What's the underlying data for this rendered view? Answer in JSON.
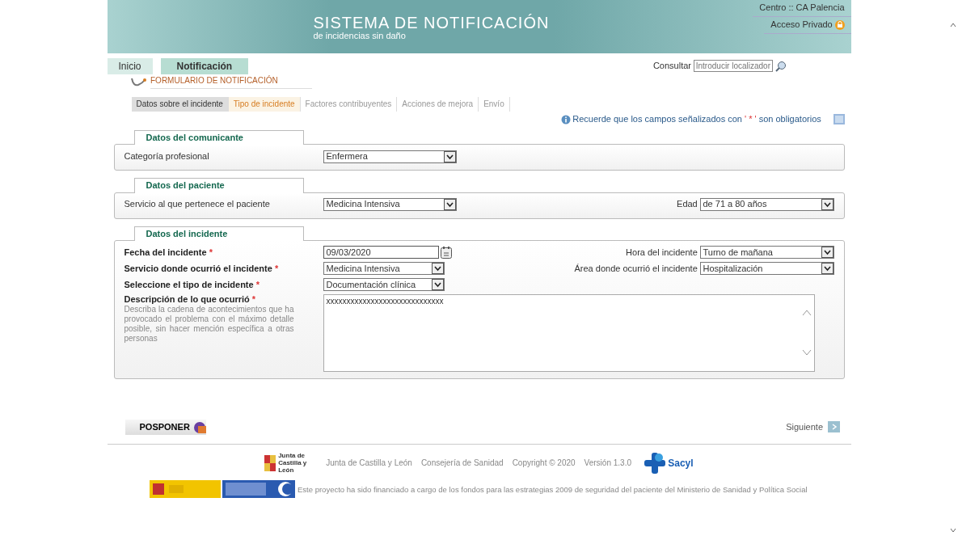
{
  "header": {
    "title": "SISTEMA DE NOTIFICACIÓN",
    "subtitle": "de incidencias sin daño",
    "centro": "Centro :: CA Palencia",
    "acceso": "Acceso Privado"
  },
  "main_tabs": [
    {
      "label": "Inicio",
      "selected": false
    },
    {
      "label": "Notificación",
      "selected": true
    }
  ],
  "search": {
    "label": "Consultar",
    "placeholder": "Introducir localizador"
  },
  "form_title": "FORMULARIO DE NOTIFICACIÓN",
  "form_tabs": [
    {
      "label": "Datos sobre el incidente",
      "selected": true,
      "enabled": true
    },
    {
      "label": "Tipo de incidente",
      "selected": false,
      "enabled": true
    },
    {
      "label": "Factores contribuyentes",
      "selected": false,
      "enabled": false
    },
    {
      "label": "Acciones de mejora",
      "selected": false,
      "enabled": false
    },
    {
      "label": "Envío",
      "selected": false,
      "enabled": false
    }
  ],
  "note": {
    "before": "Recuerde que los campos señalizados con",
    "mark": "' * '",
    "after": "son obligatorios"
  },
  "sections": [
    {
      "legend": "Datos del comunicante",
      "left": [
        {
          "label": "Categoría profesional",
          "required": false,
          "kind": "select",
          "value": "Enfermera"
        }
      ]
    },
    {
      "legend": "Datos del paciente",
      "left": [
        {
          "label": "Servicio al que pertenece el paciente",
          "required": false,
          "kind": "select",
          "value": "Medicina Intensiva"
        }
      ],
      "right": [
        {
          "label": "Edad",
          "kind": "select",
          "value": "de 71 a 80 años"
        }
      ]
    },
    {
      "legend": "Datos del incidente",
      "left": [
        {
          "label": "Fecha del incidente",
          "required": true,
          "required_mark": "*",
          "kind": "date",
          "value": "09/03/2020"
        },
        {
          "label": "Servicio donde ocurrió el incidente",
          "required": true,
          "required_mark": "*",
          "kind": "select",
          "value": "Medicina Intensiva"
        },
        {
          "label": "Seleccione el tipo de incidente",
          "required": true,
          "required_mark": "*",
          "kind": "select",
          "value": "Documentación clínica"
        },
        {
          "label": "Descripción de lo que ocurrió",
          "required": true,
          "required_mark": "*",
          "kind": "textarea",
          "hint": "Describa la cadena de acontecimientos que ha provocado el problema con el máximo detalle posible, sin hacer mención específica a otras personas",
          "value": "xxxxxxxxxxxxxxxxxxxxxxxxxxxxx"
        }
      ],
      "right": [
        {
          "label": "Hora del incidente",
          "kind": "select",
          "value": "Turno de mañana"
        },
        {
          "label": "Área donde ocurrió el incidente",
          "kind": "select",
          "value": "Hospitalización"
        }
      ]
    }
  ],
  "buttons": {
    "postpone": "POSPONER",
    "next": "Siguiente"
  },
  "footer": {
    "junta_logo": "Junta de Castilla y León",
    "links": [
      "Junta de Castilla y León",
      "Consejería de Sanidad",
      "Copyright © 2020",
      "Versión 1.3.0"
    ],
    "sacyl_logo": "Sacyl",
    "funding": "Este proyecto ha sido financiado a cargo de los fondos para las estrategias 2009 de seguridad del paciente del Ministerio de Sanidad y Política Social"
  }
}
